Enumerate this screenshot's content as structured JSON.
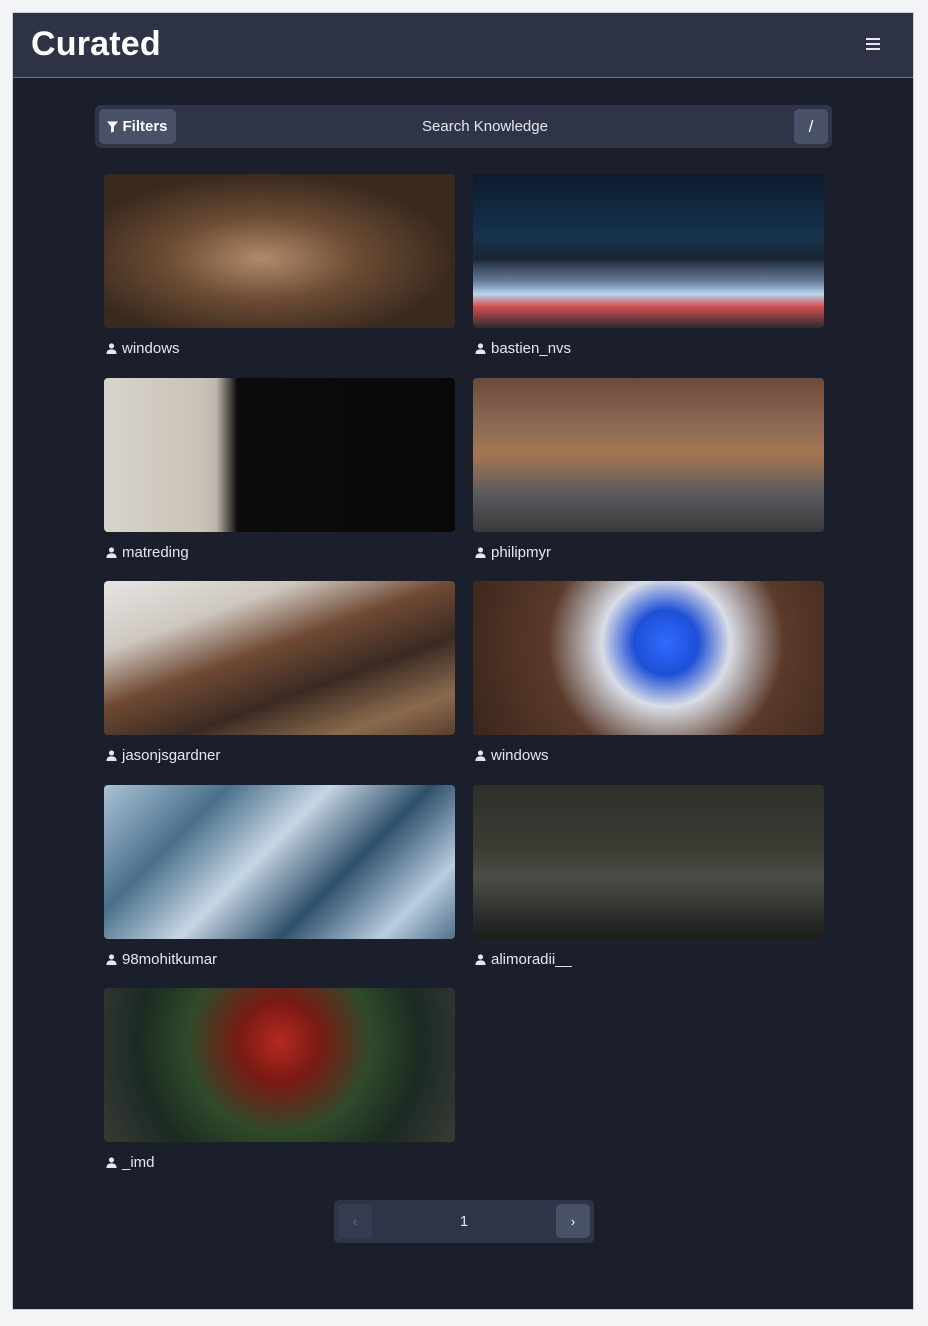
{
  "header": {
    "title": "Curated",
    "menu_icon": "hamburger-menu-icon"
  },
  "search": {
    "filters_label": "Filters",
    "filters_icon": "funnel-icon",
    "placeholder": "Search Knowledge",
    "shortcut_key": "/"
  },
  "gallery": {
    "user_icon": "user-icon",
    "items": [
      {
        "author": "windows"
      },
      {
        "author": "bastien_nvs"
      },
      {
        "author": "matreding"
      },
      {
        "author": "philipmyr"
      },
      {
        "author": "jasonjsgardner"
      },
      {
        "author": "windows"
      },
      {
        "author": "98mohitkumar"
      },
      {
        "author": "alimoradii__"
      },
      {
        "author": "_imd"
      }
    ]
  },
  "pagination": {
    "prev": "‹",
    "current_page": "1",
    "next": "›"
  },
  "colors": {
    "background": "#1b1f2c",
    "topbar": "#2e3446",
    "control": "#485167"
  }
}
